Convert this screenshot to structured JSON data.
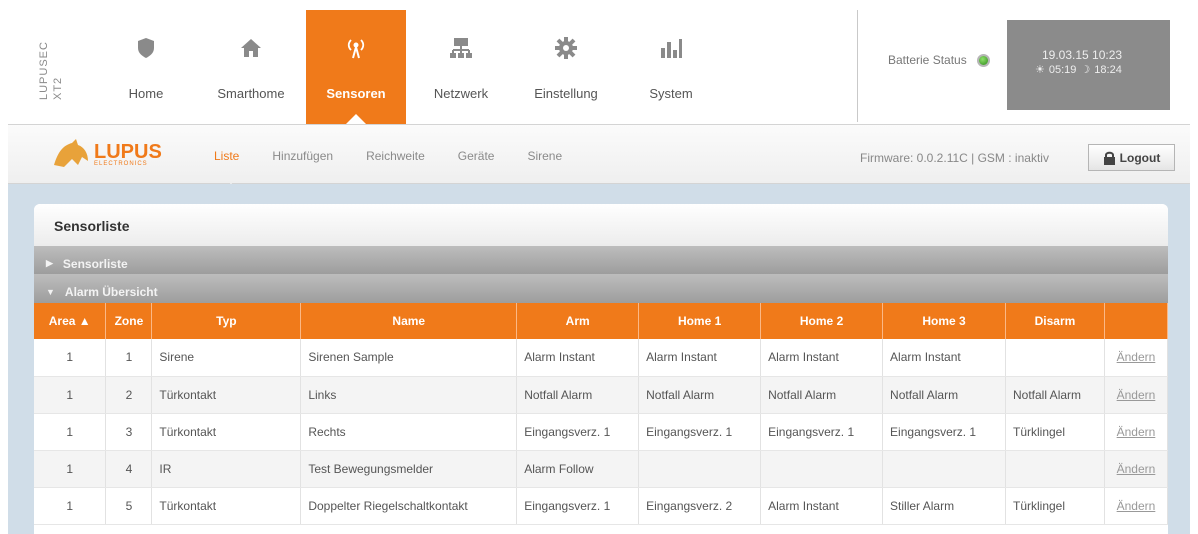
{
  "brand": {
    "line1": "LUPUSEC",
    "line2": "XT2"
  },
  "nav": [
    {
      "label": "Home",
      "icon": "shield-icon",
      "active": false
    },
    {
      "label": "Smarthome",
      "icon": "house-icon",
      "active": false
    },
    {
      "label": "Sensoren",
      "icon": "antenna-icon",
      "active": true
    },
    {
      "label": "Netzwerk",
      "icon": "network-icon",
      "active": false
    },
    {
      "label": "Einstellung",
      "icon": "gear-icon",
      "active": false
    },
    {
      "label": "System",
      "icon": "bar-chart-icon",
      "active": false
    }
  ],
  "status": {
    "battery_label": "Batterie Status",
    "battery_color": "#3fae22",
    "datetime": "19.03.15 10:23",
    "sunrise": "05:19",
    "sunset": "18:24"
  },
  "logo": {
    "word": "LUPUS",
    "sub": "ELECTRONICS"
  },
  "subnav": [
    {
      "label": "Liste",
      "active": true
    },
    {
      "label": "Hinzufügen",
      "active": false
    },
    {
      "label": "Reichweite",
      "active": false
    },
    {
      "label": "Geräte",
      "active": false
    },
    {
      "label": "Sirene",
      "active": false
    }
  ],
  "firmware_text": "Firmware: 0.0.2.11C | GSM : inaktiv",
  "logout_label": "Logout",
  "panel": {
    "title": "Sensorliste",
    "acc1": "Sensorliste",
    "acc2": "Alarm Übersicht"
  },
  "table": {
    "headers": [
      "Area ▲",
      "Zone",
      "Typ",
      "Name",
      "Arm",
      "Home 1",
      "Home 2",
      "Home 3",
      "Disarm",
      ""
    ],
    "rows": [
      [
        "1",
        "1",
        "Sirene",
        "Sirenen Sample",
        "Alarm Instant",
        "Alarm Instant",
        "Alarm Instant",
        "Alarm Instant",
        "",
        "Ändern"
      ],
      [
        "1",
        "2",
        "Türkontakt",
        "Links",
        "Notfall Alarm",
        "Notfall Alarm",
        "Notfall Alarm",
        "Notfall Alarm",
        "Notfall Alarm",
        "Ändern"
      ],
      [
        "1",
        "3",
        "Türkontakt",
        "Rechts",
        "Eingangsverz. 1",
        "Eingangsverz. 1",
        "Eingangsverz. 1",
        "Eingangsverz. 1",
        "Türklingel",
        "Ändern"
      ],
      [
        "1",
        "4",
        "IR",
        "Test Bewegungsmelder",
        "Alarm Follow",
        "",
        "",
        "",
        "",
        "Ändern"
      ],
      [
        "1",
        "5",
        "Türkontakt",
        "Doppelter Riegelschaltkontakt",
        "Eingangsverz. 1",
        "Eingangsverz. 2",
        "Alarm Instant",
        "Stiller Alarm",
        "Türklingel",
        "Ändern"
      ]
    ]
  },
  "colors": {
    "accent": "#f07a1a",
    "content_bg": "#d0dde8",
    "accordion": "#a9a9a9"
  }
}
